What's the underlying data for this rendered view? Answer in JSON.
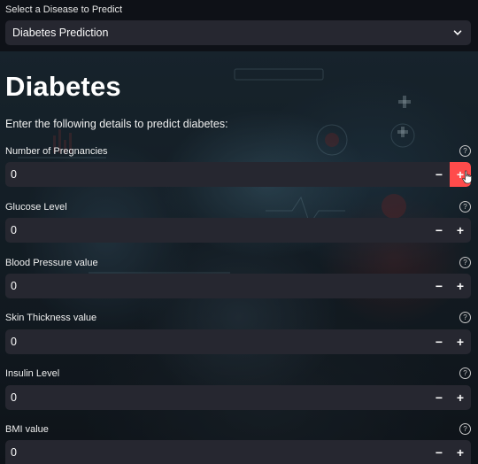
{
  "sidebar_select": {
    "label": "Select a Disease to Predict",
    "value": "Diabetes Prediction"
  },
  "page": {
    "title": "Diabetes",
    "intro": "Enter the following details to predict diabetes:"
  },
  "fields": [
    {
      "label": "Number of Pregnancies",
      "value": "0"
    },
    {
      "label": "Glucose Level",
      "value": "0"
    },
    {
      "label": "Blood Pressure value",
      "value": "0"
    },
    {
      "label": "Skin Thickness value",
      "value": "0"
    },
    {
      "label": "Insulin Level",
      "value": "0"
    },
    {
      "label": "BMI value",
      "value": "0"
    }
  ],
  "controls": {
    "minus": "−",
    "plus": "+",
    "help": "?"
  },
  "colors": {
    "accent": "#ff4b4b",
    "input_bg": "#262730",
    "page_bg": "#0e1117"
  },
  "icons": {
    "dropdown": "chevron-down-icon",
    "help": "help-circle-icon",
    "cursor": "hand-pointer-icon"
  }
}
